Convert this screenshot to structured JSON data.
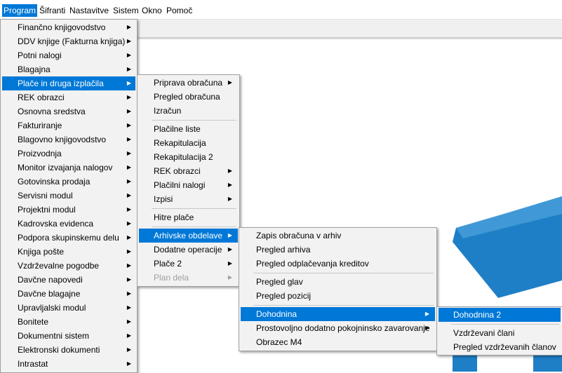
{
  "menubar": {
    "items": [
      "Program",
      "Šifranti",
      "Nastavitve",
      "Sistem",
      "Okno",
      "Pomoč"
    ]
  },
  "menus": {
    "program": [
      "Finančno knjigovodstvo",
      "DDV knjige (Fakturna knjiga)",
      "Potni nalogi",
      "Blagajna",
      "Plače in druga izplačila",
      "REK obrazci",
      "Osnovna sredstva",
      "Fakturiranje",
      "Blagovno knjigovodstvo",
      "Proizvodnja",
      "Monitor izvajanja nalogov",
      "Gotovinska prodaja",
      "Servisni modul",
      "Projektni modul",
      "Kadrovska evidenca",
      "Podpora skupinskemu delu",
      "Knjiga pošte",
      "Vzdrževalne pogodbe",
      "Davčne napovedi",
      "Davčne blagajne",
      "Upravljalski modul",
      "Bonitete",
      "Dokumentni sistem",
      "Elektronski dokumenti",
      "Intrastat"
    ],
    "place": [
      "Priprava obračuna",
      "Pregled obračuna",
      "Izračun",
      "Plačilne liste",
      "Rekapitulacija",
      "Rekapitulacija 2",
      "REK obrazci",
      "Plačilni nalogi",
      "Izpisi",
      "Hitre plače",
      "Arhivske obdelave",
      "Dodatne operacije",
      "Plače 2",
      "Plan dela"
    ],
    "arhivske": [
      "Zapis obračuna v arhiv",
      "Pregled arhiva",
      "Pregled odplačevanja kreditov",
      "Pregled glav",
      "Pregled pozicij",
      "Dohodnina",
      "Prostovoljno dodatno pokojninsko zavarovanje",
      "Obrazec M4"
    ],
    "dohodnina": [
      "Dohodnina 2",
      "Vzdrževani člani",
      "Pregled vzdrževanih članov"
    ]
  },
  "colors": {
    "highlight": "#0078d7",
    "menu_bg": "#f2f2f2",
    "logo": "#1f7fc6"
  },
  "icons": {
    "submenu": "chevron-right-icon"
  }
}
